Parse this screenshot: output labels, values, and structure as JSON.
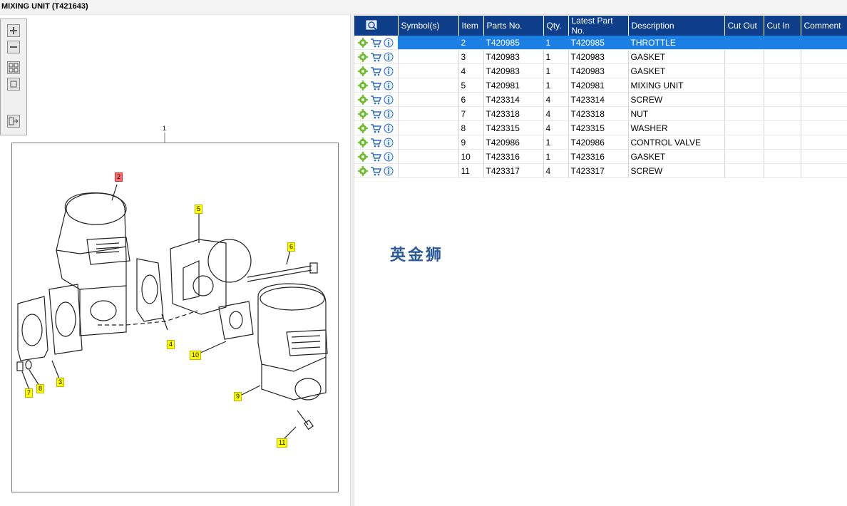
{
  "window": {
    "title": "MIXING UNIT (T421643)"
  },
  "toolbar": {
    "buttons": [
      {
        "name": "zoom-in-button",
        "icon": "plus-icon"
      },
      {
        "name": "zoom-out-button",
        "icon": "minus-icon"
      },
      {
        "name": "fit-all-button",
        "icon": "fit-icon"
      },
      {
        "name": "fit-window-button",
        "icon": "square-icon"
      },
      {
        "name": "export-button",
        "icon": "export-icon"
      }
    ]
  },
  "diagram": {
    "main_label": "1",
    "callouts": [
      {
        "id": "2",
        "highlight": true
      },
      {
        "id": "3"
      },
      {
        "id": "4"
      },
      {
        "id": "5"
      },
      {
        "id": "6"
      },
      {
        "id": "7"
      },
      {
        "id": "8"
      },
      {
        "id": "9"
      },
      {
        "id": "10"
      },
      {
        "id": "11"
      }
    ]
  },
  "table": {
    "columns": [
      "",
      "Symbol(s)",
      "Item",
      "Parts No.",
      "Qty.",
      "Latest Part No.",
      "Description",
      "Cut Out",
      "Cut In",
      "Comment"
    ],
    "rows": [
      {
        "item": "2",
        "part": "T420985",
        "qty": "1",
        "latest": "T420985",
        "desc": "THROTTLE",
        "selected": true
      },
      {
        "item": "3",
        "part": "T420983",
        "qty": "1",
        "latest": "T420983",
        "desc": "GASKET"
      },
      {
        "item": "4",
        "part": "T420983",
        "qty": "1",
        "latest": "T420983",
        "desc": "GASKET"
      },
      {
        "item": "5",
        "part": "T420981",
        "qty": "1",
        "latest": "T420981",
        "desc": "MIXING UNIT"
      },
      {
        "item": "6",
        "part": "T423314",
        "qty": "4",
        "latest": "T423314",
        "desc": "SCREW"
      },
      {
        "item": "7",
        "part": "T423318",
        "qty": "4",
        "latest": "T423318",
        "desc": "NUT"
      },
      {
        "item": "8",
        "part": "T423315",
        "qty": "4",
        "latest": "T423315",
        "desc": "WASHER"
      },
      {
        "item": "9",
        "part": "T420986",
        "qty": "1",
        "latest": "T420986",
        "desc": "CONTROL VALVE"
      },
      {
        "item": "10",
        "part": "T423316",
        "qty": "1",
        "latest": "T423316",
        "desc": "GASKET"
      },
      {
        "item": "11",
        "part": "T423317",
        "qty": "4",
        "latest": "T423317",
        "desc": "SCREW"
      }
    ]
  },
  "watermark": "英金狮",
  "colors": {
    "header": "#0f3f8b",
    "selected": "#1b7fe3",
    "callout": "#ffff00",
    "callout_active": "#ff6b6b"
  }
}
